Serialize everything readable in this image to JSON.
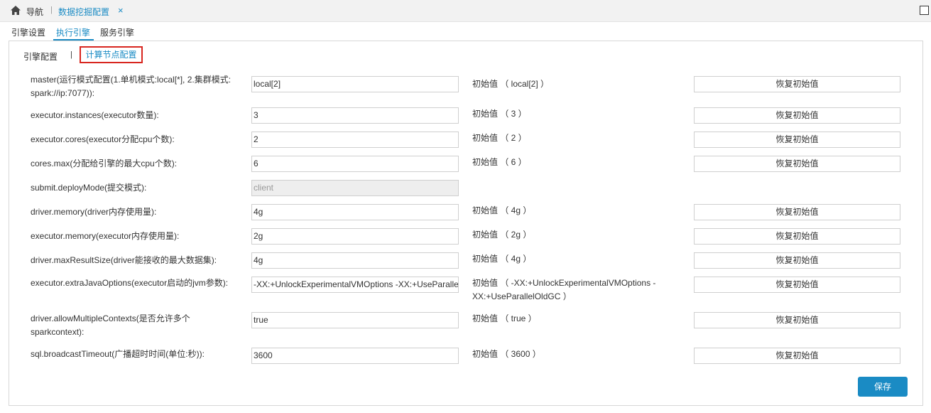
{
  "topbar": {
    "home_label": "导航",
    "active_tab": "数据挖掘配置",
    "close_symbol": "×",
    "icons": {
      "home": "home-icon",
      "close": "close-icon",
      "maximize": "maximize-icon"
    }
  },
  "subtabs": [
    {
      "label": "引擎设置",
      "active": false
    },
    {
      "label": "执行引擎",
      "active": true
    },
    {
      "label": "服务引擎",
      "active": false
    }
  ],
  "inner_tabs": {
    "engine_config": "引擎配置",
    "separator": "|",
    "compute_node_config": "计算节点配置",
    "active": "compute_node_config"
  },
  "reset_label": "恢复初始值",
  "save_label": "保存",
  "accent_color": "#1a8bc4",
  "highlight_color": "#d8261f",
  "rows": [
    {
      "label": "master(运行模式配置(1.单机模式:local[*], 2.集群模式: spark://ip:7077)):",
      "value": "local[2]",
      "initial": "初始值 （ local[2] ）"
    },
    {
      "label": "executor.instances(executor数量):",
      "value": "3",
      "initial": "初始值 （ 3 ）"
    },
    {
      "label": "executor.cores(executor分配cpu个数):",
      "value": "2",
      "initial": "初始值 （ 2 ）"
    },
    {
      "label": "cores.max(分配给引擎的最大cpu个数):",
      "value": "6",
      "initial": "初始值 （ 6 ）"
    },
    {
      "label": "submit.deployMode(提交模式):",
      "value": "client",
      "initial": "",
      "disabled": true
    },
    {
      "label": "driver.memory(driver内存使用量):",
      "value": "4g",
      "initial": "初始值 （ 4g ）"
    },
    {
      "label": "executor.memory(executor内存使用量):",
      "value": "2g",
      "initial": "初始值 （ 2g ）"
    },
    {
      "label": "driver.maxResultSize(driver能接收的最大数据集):",
      "value": "4g",
      "initial": "初始值 （ 4g ）"
    },
    {
      "label": "executor.extraJavaOptions(executor启动的jvm参数):",
      "value": "-XX:+UnlockExperimentalVMOptions -XX:+UseParallelOldGC",
      "initial": "初始值 （ -XX:+UnlockExperimentalVMOptions -XX:+UseParallelOldGC ）"
    },
    {
      "label": "driver.allowMultipleContexts(是否允许多个sparkcontext):",
      "value": "true",
      "initial": "初始值 （ true ）"
    },
    {
      "label": "sql.broadcastTimeout(广播超时时间(单位:秒)):",
      "value": "3600",
      "initial": "初始值 （ 3600 ）"
    }
  ]
}
